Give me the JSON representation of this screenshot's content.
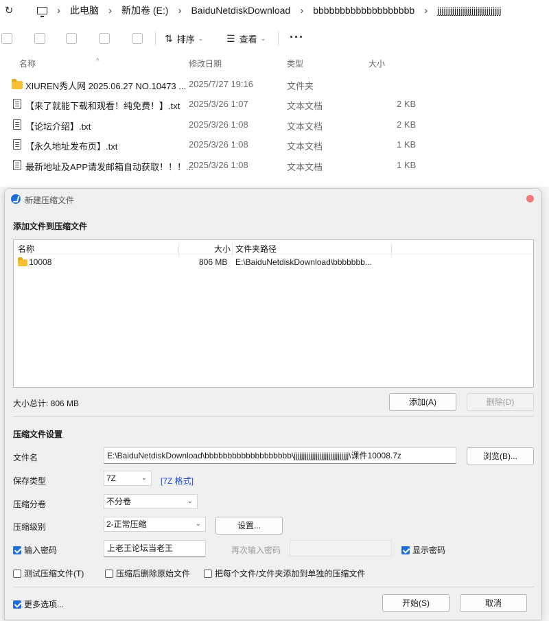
{
  "explorer": {
    "breadcrumb": [
      "此电脑",
      "新加卷 (E:)",
      "BaiduNetdiskDownload",
      "bbbbbbbbbbbbbbbbbbb",
      "jjjjjjjjjjjjjjjjjjjjjjjjjjjjjj"
    ],
    "toolbar": {
      "sort_label": "排序",
      "view_label": "查看",
      "more_label": "···"
    },
    "columns": {
      "name": "名称",
      "date": "修改日期",
      "type": "类型",
      "size": "大小"
    },
    "files": [
      {
        "icon": "folder-icon",
        "name": "XIUREN秀人网 2025.06.27 NO.10473 ...",
        "date": "2025/7/27 19:16",
        "type": "文件夹",
        "size": ""
      },
      {
        "icon": "text-file-icon",
        "name": "【来了就能下载和观看！纯免费！】.txt",
        "date": "2025/3/26 1:07",
        "type": "文本文档",
        "size": "2 KB"
      },
      {
        "icon": "text-file-icon",
        "name": "【论坛介绍】.txt",
        "date": "2025/3/26 1:08",
        "type": "文本文档",
        "size": "2 KB"
      },
      {
        "icon": "text-file-icon",
        "name": "【永久地址发布页】.txt",
        "date": "2025/3/26 1:08",
        "type": "文本文档",
        "size": "1 KB"
      },
      {
        "icon": "text-file-icon",
        "name": "最新地址及APP请发邮箱自动获取！！！...",
        "date": "2025/3/26 1:08",
        "type": "文本文档",
        "size": "1 KB"
      }
    ]
  },
  "dialog": {
    "title": "新建压缩文件",
    "add_section_title": "添加文件到压缩文件",
    "list_columns": {
      "name": "名称",
      "size": "大小",
      "path": "文件夹路径"
    },
    "list_rows": [
      {
        "name": "10008",
        "size": "806 MB",
        "path": "E:\\BaiduNetdiskDownload\\bbbbbbb..."
      }
    ],
    "total_size": "大小总计: 806 MB",
    "add_button": "添加(A)",
    "delete_button": "删除(D)",
    "settings_title": "压缩文件设置",
    "filename_label": "文件名",
    "filename_value": "E:\\BaiduNetdiskDownload\\bbbbbbbbbbbbbbbbbbb\\jjjjjjjjjjjjjjjjjjjjjjjjjjjjjj\\课件10008.7z",
    "browse_button": "浏览(B)...",
    "save_type_label": "保存类型",
    "save_type_value": "7Z",
    "format_link": "[7Z 格式]",
    "volume_label": "压缩分卷",
    "volume_value": "不分卷",
    "level_label": "压缩级别",
    "level_value": "2-正常压缩",
    "settings_button": "设置...",
    "password_label": "输入密码",
    "password_value": "上老王论坛当老王",
    "reenter_label": "再次输入密码",
    "show_password_label": "显示密码",
    "test_label": "测试压缩文件(T)",
    "delete_after_label": "压缩后删除原始文件",
    "separate_label": "把每个文件/文件夹添加到单独的压缩文件",
    "more_options_label": "更多选项...",
    "start_button": "开始(S)",
    "cancel_button": "取消"
  }
}
